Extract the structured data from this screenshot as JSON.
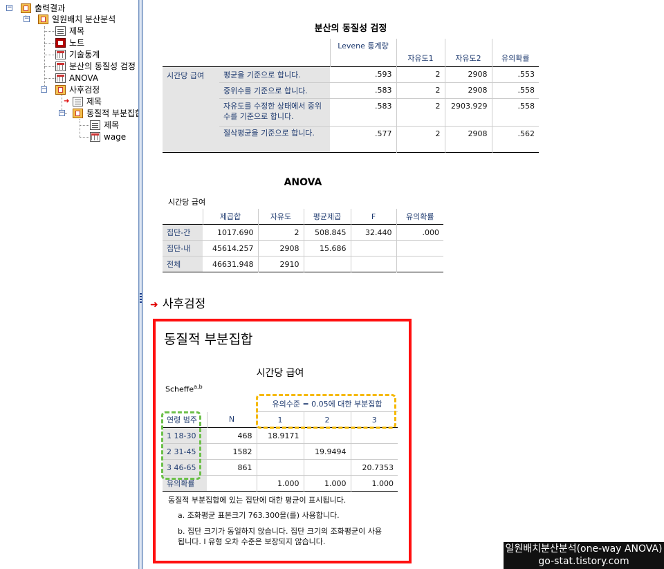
{
  "outline": {
    "items": [
      {
        "label": "출력결과"
      },
      {
        "label": "일원배치 분산분석"
      },
      {
        "label": "제목"
      },
      {
        "label": "노트"
      },
      {
        "label": "기술통계"
      },
      {
        "label": "분산의 동질성 검정"
      },
      {
        "label": "ANOVA"
      },
      {
        "label": "사후검정"
      },
      {
        "label": "제목"
      },
      {
        "label": "동질적 부분집합"
      },
      {
        "label": "제목"
      },
      {
        "label": "wage"
      }
    ]
  },
  "levene": {
    "title": "분산의 동질성 검정",
    "headers": [
      "Levene 통계량",
      "자유도1",
      "자유도2",
      "유의확률"
    ],
    "row_group": "시간당 급여",
    "rows": [
      {
        "label": "평균을 기준으로 합니다.",
        "stat": ".593",
        "df1": "2",
        "df2": "2908",
        "sig": ".553"
      },
      {
        "label": "중위수를 기준으로 합니다.",
        "stat": ".583",
        "df1": "2",
        "df2": "2908",
        "sig": ".558"
      },
      {
        "label": "자유도를 수정한 상태에서 중위수를 기준으로 합니다.",
        "stat": ".583",
        "df1": "2",
        "df2": "2903.929",
        "sig": ".558"
      },
      {
        "label": "절삭평균을 기준으로 합니다.",
        "stat": ".577",
        "df1": "2",
        "df2": "2908",
        "sig": ".562"
      }
    ]
  },
  "anova": {
    "title": "ANOVA",
    "subtitle": "시간당 급여",
    "headers": [
      "제곱합",
      "자유도",
      "평균제곱",
      "F",
      "유의확률"
    ],
    "rows": [
      {
        "label": "집단-간",
        "ss": "1017.690",
        "df": "2",
        "ms": "508.845",
        "f": "32.440",
        "sig": ".000"
      },
      {
        "label": "집단-내",
        "ss": "45614.257",
        "df": "2908",
        "ms": "15.686",
        "f": "",
        "sig": ""
      },
      {
        "label": "전체",
        "ss": "46631.948",
        "df": "2910",
        "ms": "",
        "f": "",
        "sig": ""
      }
    ]
  },
  "posthoc": {
    "heading": "사후검정"
  },
  "subsets": {
    "heading": "동질적 부분집합",
    "title": "시간당 급여",
    "method": "Scheffe",
    "method_sup": "a,b",
    "span_header": "유의수준 = 0.05에 대한 부분집합",
    "col_group": "연령 범주",
    "col_n": "N",
    "col_subsets": [
      "1",
      "2",
      "3"
    ],
    "rows": [
      {
        "label": "1 18-30",
        "n": "468",
        "s1": "18.9171",
        "s2": "",
        "s3": ""
      },
      {
        "label": "2 31-45",
        "n": "1582",
        "s1": "",
        "s2": "19.9494",
        "s3": ""
      },
      {
        "label": "3 46-65",
        "n": "861",
        "s1": "",
        "s2": "",
        "s3": "20.7353"
      }
    ],
    "sig_row": {
      "label": "유의확률",
      "s1": "1.000",
      "s2": "1.000",
      "s3": "1.000"
    },
    "footnote_main": "동질적 부분집합에 있는 집단에 대한 평균이 표시됩니다.",
    "footnote_a": "a. 조화평균 표본크기 763.300을(를) 사용합니다.",
    "footnote_b": "b. 집단 크기가 동일하지 않습니다. 집단 크기의 조화평균이 사용됩니다. I 유형 오차 수준은 보장되지 않습니다."
  },
  "watermark": {
    "line1": "일원배치분산분석(one-way ANOVA)",
    "line2": "go-stat.tistory.com"
  },
  "colors": {
    "highlight_red": "#ff1010",
    "highlight_yellow": "#f5b800",
    "highlight_green": "#6cc04a",
    "header_text": "#1f3b70"
  }
}
